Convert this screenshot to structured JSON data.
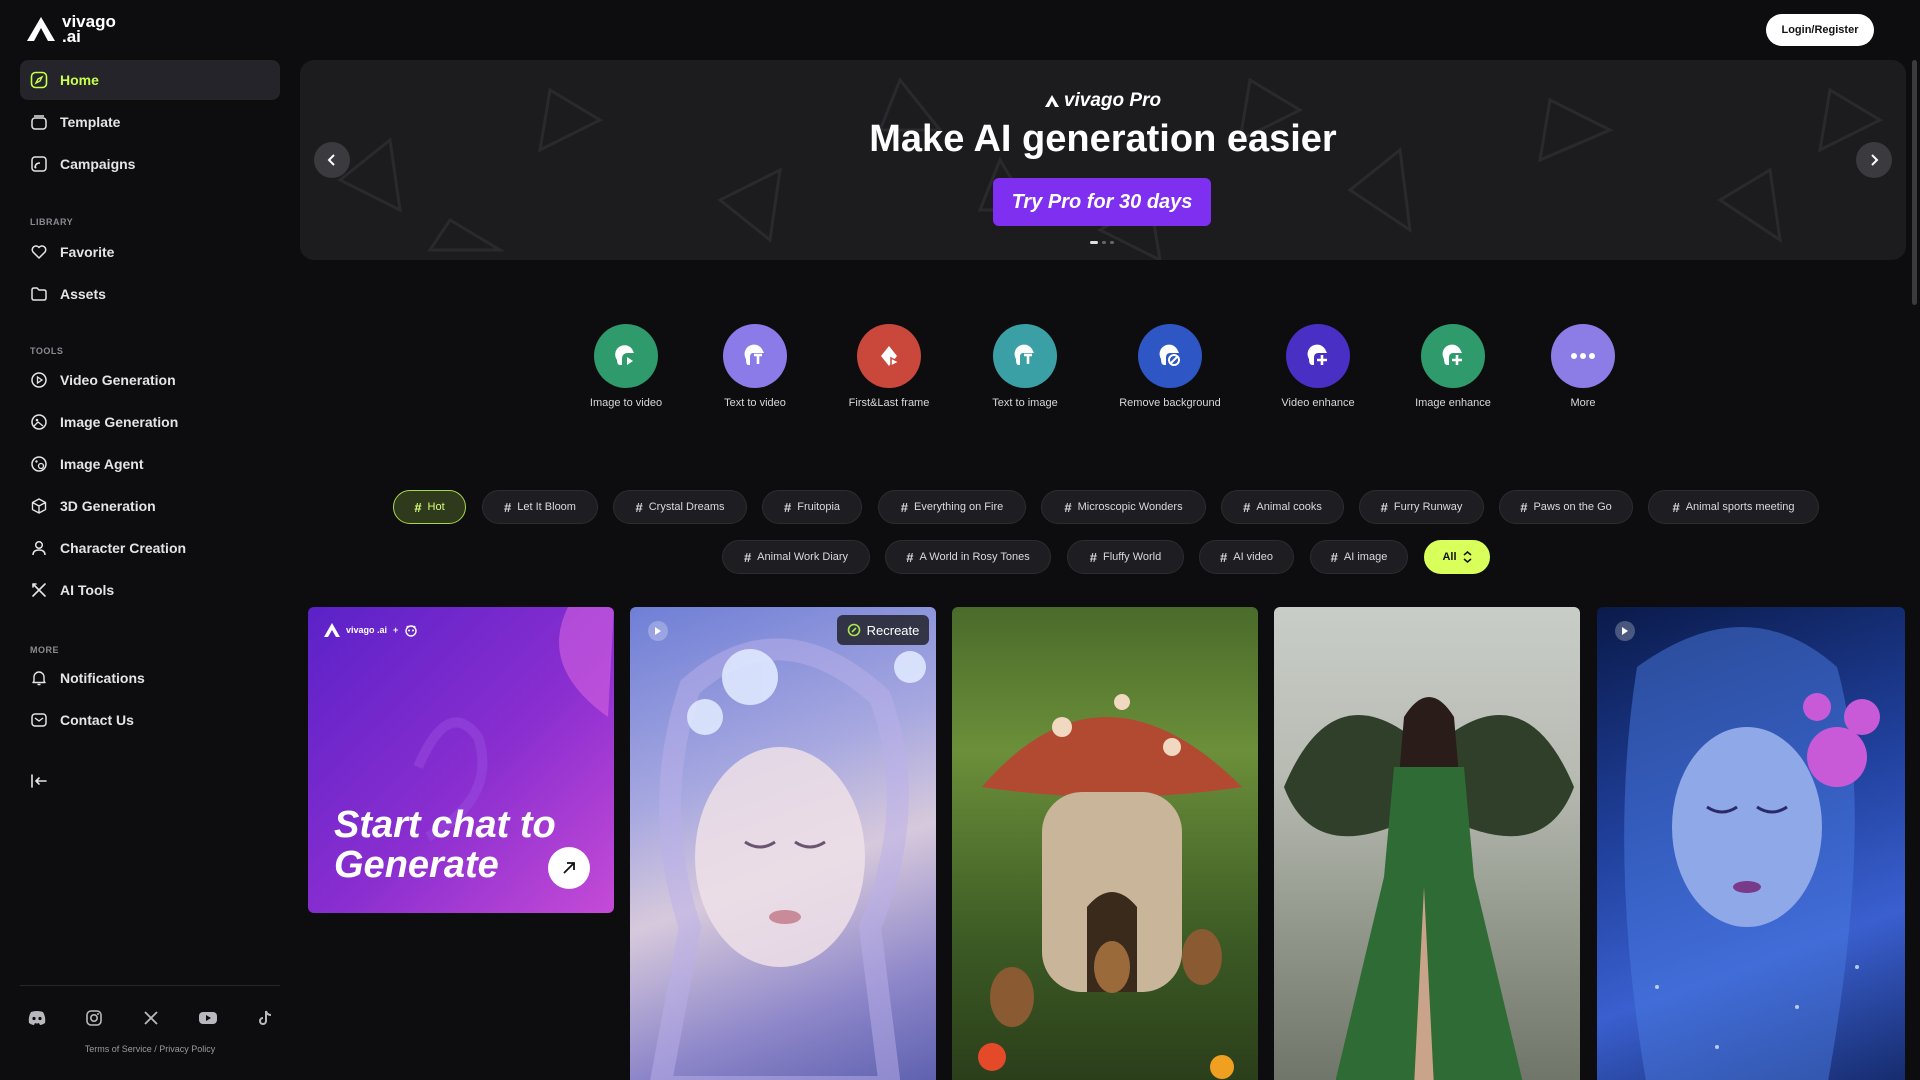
{
  "brand": {
    "name": "vivago",
    "suffix": ".ai"
  },
  "header": {
    "login_label": "Login/Register"
  },
  "sidebar": {
    "main": [
      {
        "label": "Home",
        "icon": "compass-icon",
        "active": true
      },
      {
        "label": "Template",
        "icon": "template-icon"
      },
      {
        "label": "Campaigns",
        "icon": "campaign-icon"
      }
    ],
    "library_label": "LIBRARY",
    "library": [
      {
        "label": "Favorite",
        "icon": "heart-icon"
      },
      {
        "label": "Assets",
        "icon": "folder-icon"
      }
    ],
    "tools_label": "TOOLS",
    "tools": [
      {
        "label": "Video Generation",
        "icon": "video-icon"
      },
      {
        "label": "Image Generation",
        "icon": "image-icon"
      },
      {
        "label": "Image Agent",
        "icon": "agent-icon"
      },
      {
        "label": "3D Generation",
        "icon": "cube-icon"
      },
      {
        "label": "Character Creation",
        "icon": "character-icon"
      },
      {
        "label": "AI Tools",
        "icon": "tools-icon"
      }
    ],
    "more_label": "MORE",
    "more": [
      {
        "label": "Notifications",
        "icon": "bell-icon"
      },
      {
        "label": "Contact Us",
        "icon": "mail-icon"
      }
    ],
    "socials": [
      "discord-icon",
      "instagram-icon",
      "x-icon",
      "youtube-icon",
      "tiktok-icon"
    ],
    "terms": "Terms of Service",
    "sep": "/",
    "privacy": "Privacy Policy"
  },
  "banner": {
    "brand": "vivago Pro",
    "title": "Make AI generation easier",
    "cta": "Try Pro for 30 days",
    "slide_count": 3,
    "active_slide": 1
  },
  "tools": [
    {
      "label": "Image to video",
      "color": "#2f9a6b"
    },
    {
      "label": "Text to video",
      "color": "#8b7be8"
    },
    {
      "label": "First&Last frame",
      "color": "#c9473b"
    },
    {
      "label": "Text to image",
      "color": "#3aa0a6"
    },
    {
      "label": "Remove background",
      "color": "#2e56c4"
    },
    {
      "label": "Video enhance",
      "color": "#4a2fc4"
    },
    {
      "label": "Image enhance",
      "color": "#2f9a6b"
    },
    {
      "label": "More",
      "color": "#8c7ce6"
    }
  ],
  "tags_row1": [
    "Hot",
    "Let It Bloom",
    "Crystal Dreams",
    "Fruitopia",
    "Everything on Fire",
    "Microscopic Wonders",
    "Animal cooks",
    "Furry Runway",
    "Paws on the Go",
    "Animal sports meeting"
  ],
  "tags_row2": [
    "Animal Work Diary",
    "A World in Rosy Tones",
    "Fluffy World",
    "AI video",
    "AI image"
  ],
  "tag_all": "All",
  "tag_hash": "#",
  "promo": {
    "line1": "Start chat to",
    "line2": "Generate",
    "logo": "vivago .ai",
    "plus": "+"
  },
  "recreate_label": "Recreate"
}
